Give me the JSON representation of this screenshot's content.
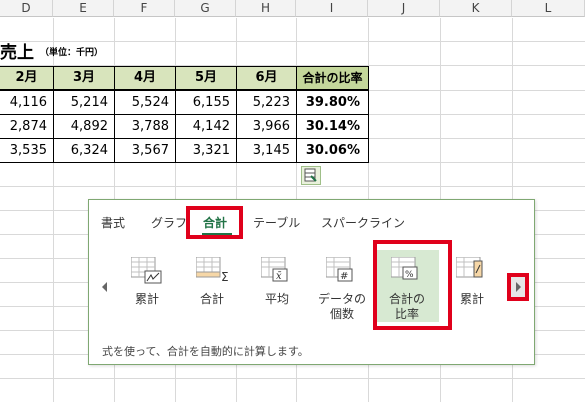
{
  "columns": [
    "D",
    "E",
    "F",
    "G",
    "H",
    "I",
    "J",
    "K",
    "L"
  ],
  "sheet": {
    "title": "売上",
    "unit": "（単位：千円）",
    "headers": [
      "2月",
      "3月",
      "4月",
      "5月",
      "6月",
      "合計の比率"
    ],
    "rows": [
      [
        "4,116",
        "5,214",
        "5,524",
        "6,155",
        "5,223",
        "39.80%"
      ],
      [
        "2,874",
        "4,892",
        "3,788",
        "4,142",
        "3,966",
        "30.14%"
      ],
      [
        "3,535",
        "6,324",
        "3,567",
        "3,321",
        "3,145",
        "30.06%"
      ]
    ]
  },
  "quick_analysis": {
    "tabs": [
      "書式",
      "グラフ",
      "合計",
      "テーブル",
      "スパークライン"
    ],
    "active_tab": "合計",
    "items": [
      {
        "label": "累計",
        "icon": "running-total-row-icon"
      },
      {
        "label": "合計",
        "icon": "sum-icon"
      },
      {
        "label": "平均",
        "icon": "average-icon"
      },
      {
        "label": "データの\n個数",
        "icon": "count-icon"
      },
      {
        "label": "合計の\n比率",
        "icon": "percent-total-icon"
      },
      {
        "label": "累計",
        "icon": "running-total-column-icon"
      }
    ],
    "selected_index": 4,
    "description": "式を使って、合計を自動的に計算します。"
  },
  "colors": {
    "header_fill": "#d8e4bc",
    "ratio_header_fill": "#c4d79b",
    "accent": "#217346",
    "highlight_red": "#e0001b",
    "selected_fill": "#d7e9d2"
  }
}
